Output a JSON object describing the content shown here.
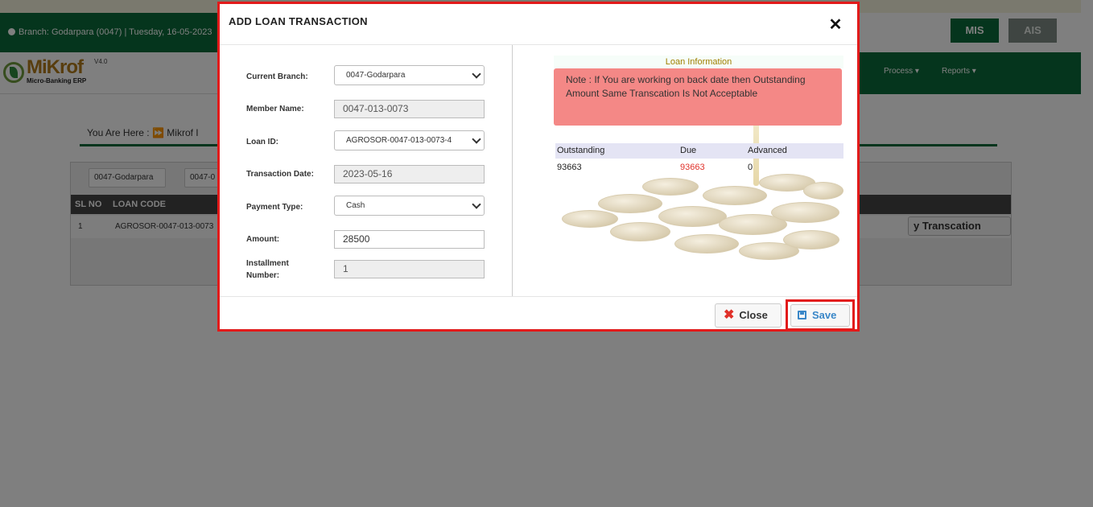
{
  "app": {
    "branch_info": "Branch: Godarpara (0047) | Tuesday, 16-05-2023",
    "buttons": {
      "mis": "MIS",
      "ais": "AIS"
    },
    "logo": {
      "name": "MiKrof",
      "version": "V4.0",
      "tagline": "Micro-Banking ERP"
    },
    "nav": [
      {
        "label": "Process"
      },
      {
        "label": "Reports"
      }
    ],
    "breadcrumb": {
      "prefix": "You Are Here",
      "sep": ":",
      "item": "Mikrof I"
    },
    "filters": [
      {
        "value": "0047-Godarpara"
      },
      {
        "value": "0047-0"
      }
    ],
    "table": {
      "headers": {
        "sl": "SL NO",
        "loan_code": "LOAN CODE"
      },
      "rows": [
        {
          "sl": "1",
          "loan_code": "AGROSOR-0047-013-0073"
        }
      ],
      "action_label": "y Transcation"
    }
  },
  "modal": {
    "title": "ADD LOAN TRANSACTION",
    "close_icon": "close-x-icon",
    "form": {
      "current_branch": {
        "label": "Current Branch:",
        "value": "0047-Godarpara"
      },
      "member_name": {
        "label": "Member Name:",
        "value": "0047-013-0073"
      },
      "loan_id": {
        "label": "Loan ID:",
        "value": "AGROSOR-0047-013-0073-4"
      },
      "transaction_date": {
        "label": "Transaction Date:",
        "value": "2023-05-16"
      },
      "payment_type": {
        "label": "Payment Type:",
        "value": "Cash"
      },
      "amount": {
        "label": "Amount:",
        "value": "28500"
      },
      "installment_number": {
        "label": "Installment Number:",
        "value": "1"
      }
    },
    "info": {
      "title": "Loan Information",
      "note": "Note : If You are working on back date then Outstanding Amount Same Transcation Is Not Acceptable",
      "headers": {
        "outstanding": "Outstanding",
        "due": "Due",
        "advanced": "Advanced"
      },
      "values": {
        "outstanding": "93663",
        "due": "93663",
        "advanced": "0"
      },
      "colors": {
        "due_value": "#e0312a",
        "note_bg": "#f48886",
        "title": "#a08000"
      }
    },
    "footer": {
      "close_label": "Close",
      "save_label": "Save"
    },
    "colors": {
      "highlight_border": "#e21a1a",
      "brand_green": "#0b6b3a"
    }
  }
}
